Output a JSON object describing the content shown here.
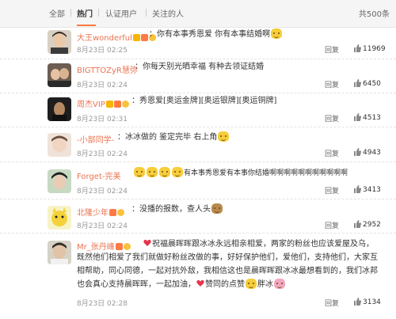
{
  "tabs": [
    {
      "label": "全部"
    },
    {
      "label": "热门"
    },
    {
      "label": "认证用户"
    },
    {
      "label": "关注的人"
    }
  ],
  "total_label": "共500条",
  "reply_label": "回复",
  "comments": [
    {
      "name": "大王wonderful",
      "text": "：你有本事秀恩爱 你有本事结婚啊",
      "date": "8月23日 02:25",
      "likes": "11969"
    },
    {
      "name": "BIGTTOZyR慧弥",
      "text": "：你每天别光晒幸福 有种去领证结婚",
      "date": "8月23日 02:24",
      "likes": "6450"
    },
    {
      "name": "周杰VIP",
      "text": "：秀恩爱[奥运金牌][奥运银牌][奥运铜牌]",
      "date": "8月23日 02:31",
      "likes": "4513"
    },
    {
      "name": "-小部同学-",
      "text": "：冰冰做的 鉴定完毕 右上角",
      "date": "8月23日 02:24",
      "likes": "4943"
    },
    {
      "name": "Forget-完美",
      "text": "有本事秀恩爱有本事你结婚啊啊啊啊啊啊啊啊啊啊啊",
      "date": "8月23日 02:24",
      "likes": "3413"
    },
    {
      "name": "北隆少年",
      "text": "：没播的报数，查人头",
      "date": "8月23日 02:24",
      "likes": "2952"
    },
    {
      "name": "Mr_张丹峰",
      "text_line1": "祝福晨晖晖跟冰冰永远相亲相爱，两家的粉丝也应该爱屋及乌，",
      "text_line2": "既然他们相爱了我们就做好粉丝改做的事，好好保护他们，爱他们，支持他们，大家互",
      "text_line3": "相帮助，同心同德，一起对抗外敌，我相信这也是晨晖晖跟冰冰最想看到的，我们冰邦",
      "text_line4": "也会真心支持晨晖晖，一起加油，",
      "text_tail1": "赞同的点赞",
      "text_tail2": "胖冰",
      "date": "8月23日 02:28",
      "likes": "3134"
    }
  ],
  "colors": {
    "accent": "#f77c3d",
    "name": "#eb7350",
    "bg_tabs": "#f5f5f5"
  }
}
